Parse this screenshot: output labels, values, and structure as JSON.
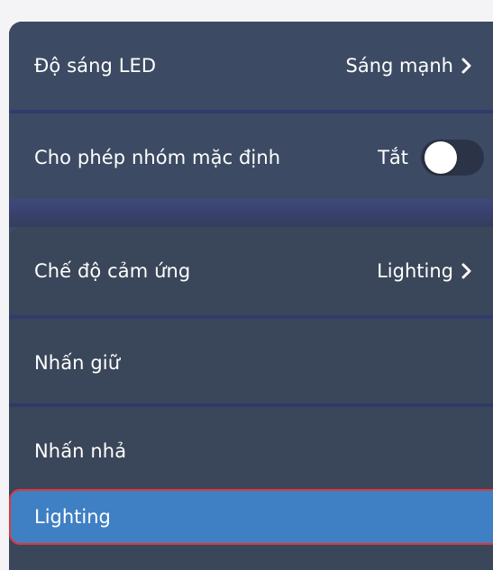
{
  "settings": {
    "led_brightness": {
      "label": "Độ sáng LED",
      "value": "Sáng mạnh",
      "icon": "chevron-right-icon"
    },
    "default_group": {
      "label": "Cho phép nhóm mặc định",
      "state_text": "Tắt",
      "enabled": false
    },
    "touch_mode": {
      "label": "Chế độ cảm ứng",
      "value": "Lighting",
      "icon": "chevron-right-icon"
    },
    "press_hold": {
      "label": "Nhấn giữ"
    },
    "press_release": {
      "label": "Nhấn nhả"
    },
    "selected_option": {
      "label": "Lighting"
    }
  },
  "colors": {
    "panel_bg": "#3c4b63",
    "divider": "#323b6e",
    "selected_bg": "#3f80c4",
    "selected_border": "#e0373a",
    "toggle_track": "#2b3447",
    "toggle_knob": "#ffffff",
    "text": "#ffffff"
  }
}
